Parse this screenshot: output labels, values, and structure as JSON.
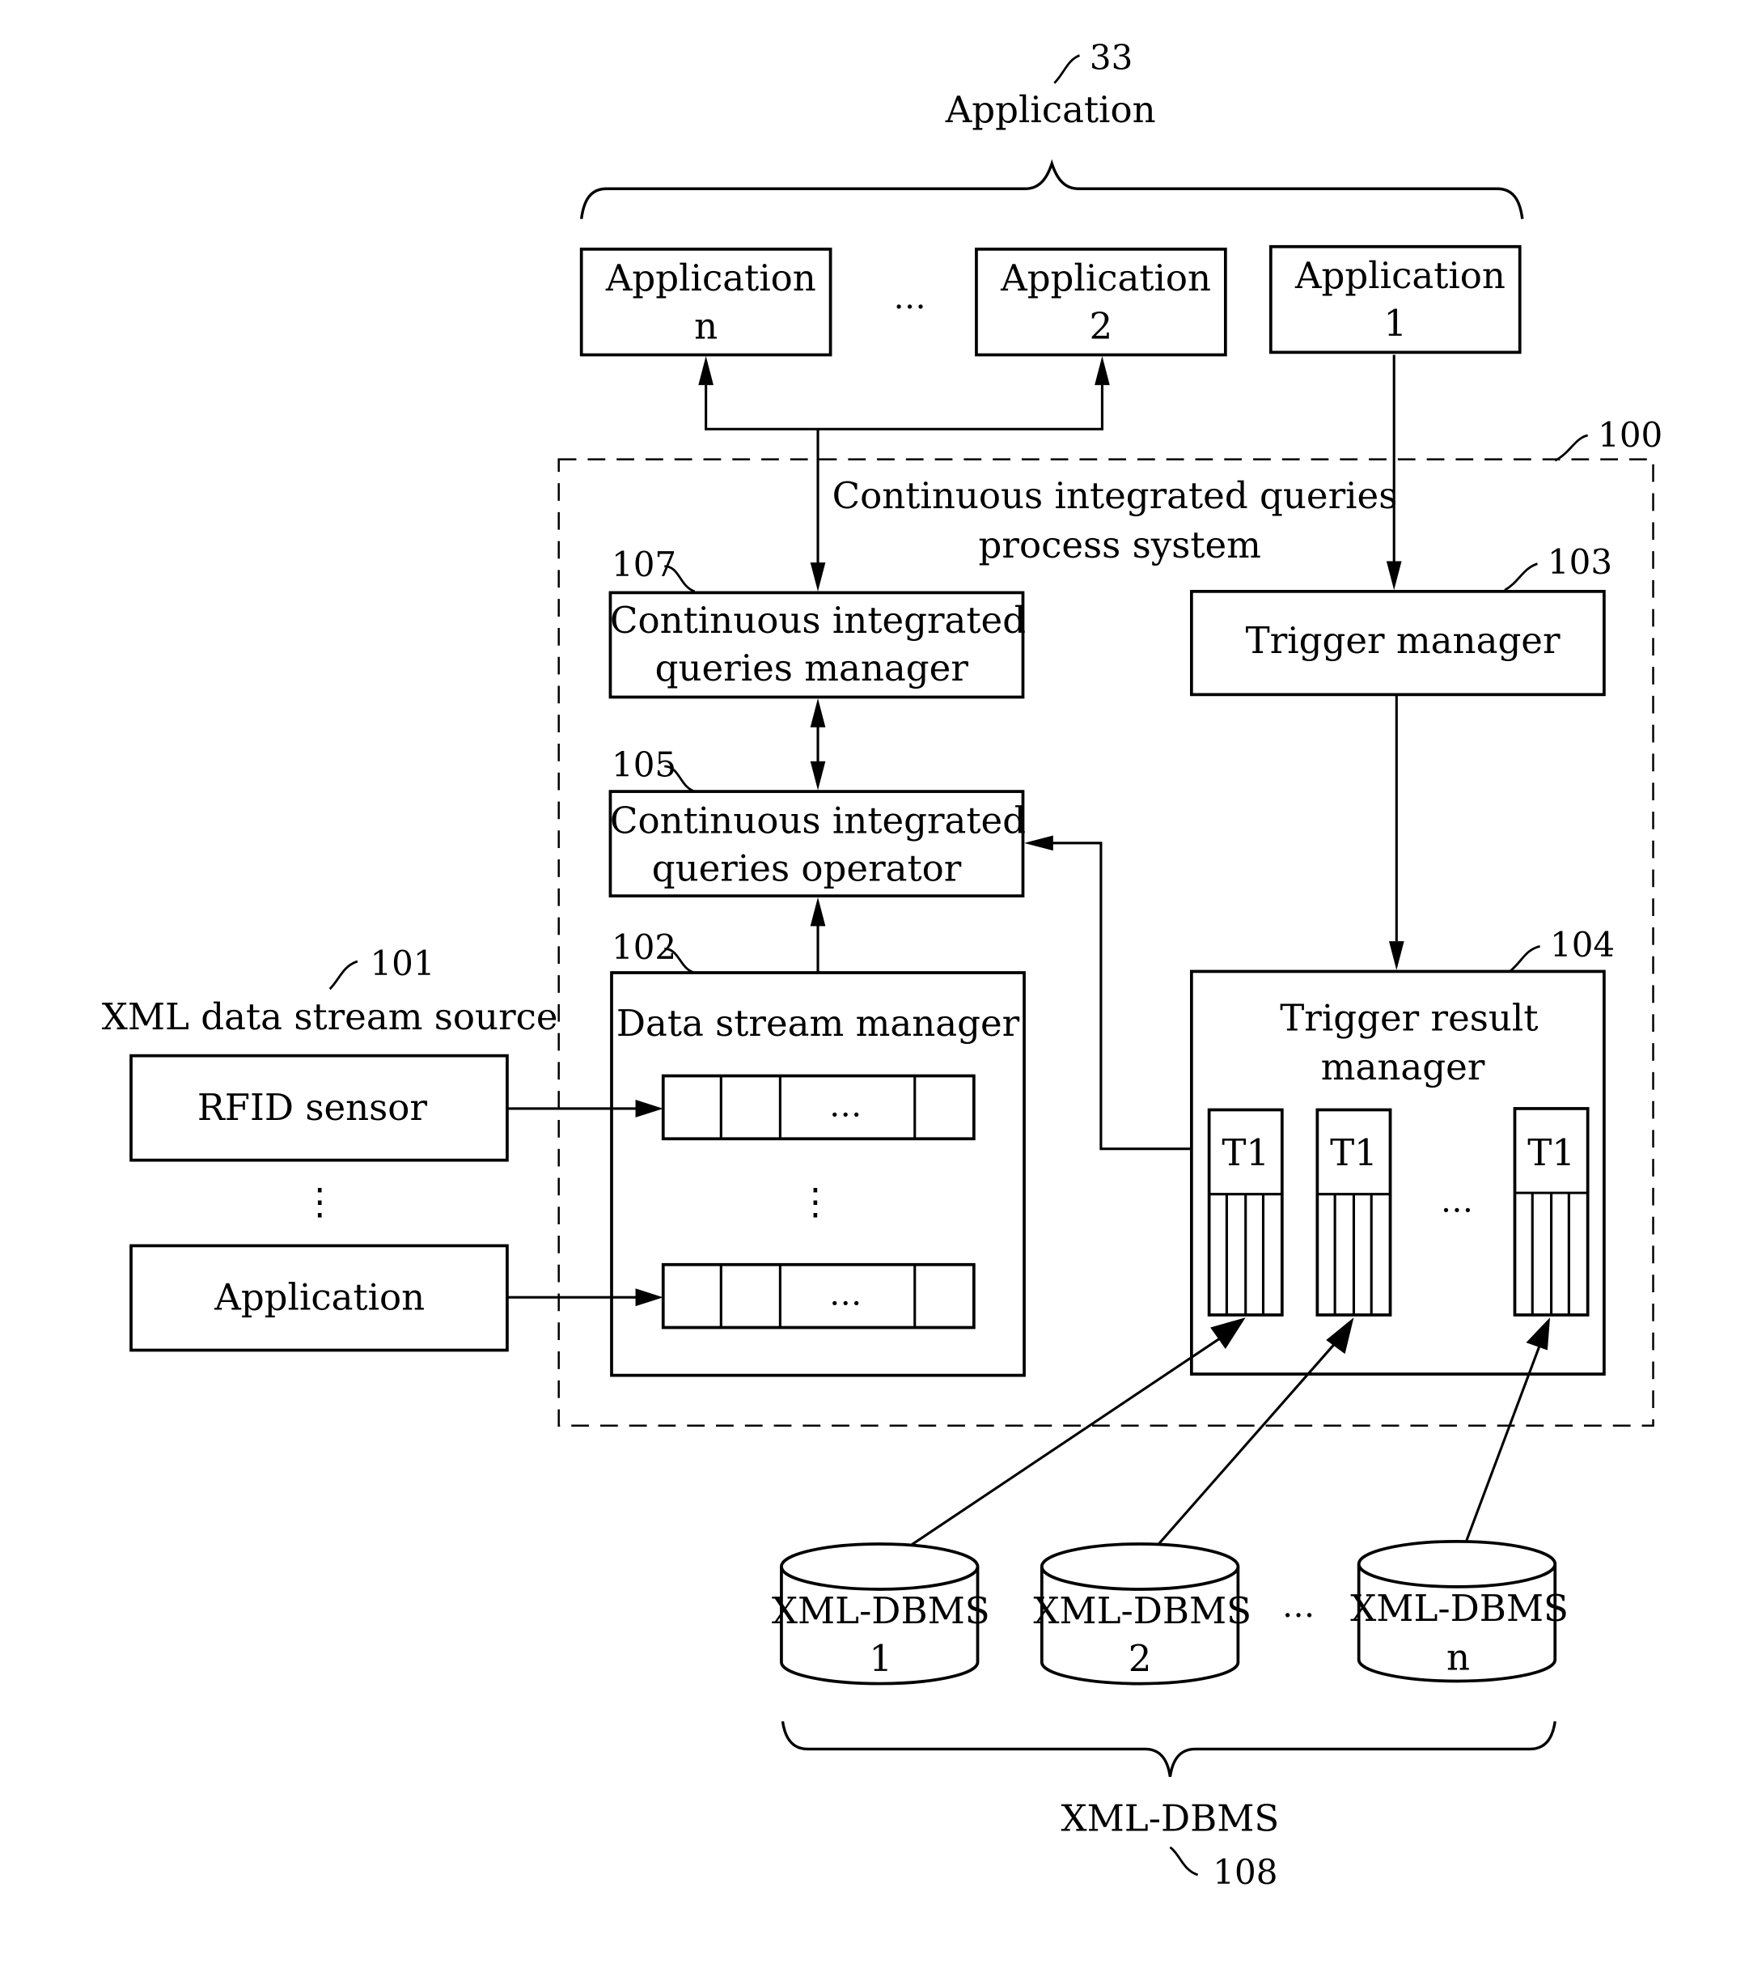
{
  "figure": {
    "application_group": {
      "label": "Application",
      "ref": "33"
    },
    "applications": [
      {
        "line1": "Application",
        "line2": "n"
      },
      {
        "line1": "Application",
        "line2": "2"
      },
      {
        "line1": "Application",
        "line2": "1"
      }
    ],
    "ellipsis": "…",
    "vdots": "⋮",
    "system": {
      "line1": "Continuous integrated queries",
      "line2": "process system",
      "ref": "100"
    },
    "cq_manager": {
      "line1": "Continuous integrated",
      "line2": "queries manager",
      "ref": "107"
    },
    "cq_operator": {
      "line1": "Continuous integrated",
      "line2": "queries operator",
      "ref": "105"
    },
    "trigger_manager": {
      "label": "Trigger manager",
      "ref": "103"
    },
    "data_stream_manager": {
      "label": "Data stream manager",
      "ref": "102"
    },
    "trigger_result_manager": {
      "line1": "Trigger result",
      "line2": "manager",
      "ref": "104",
      "tables": [
        "T1",
        "T1",
        "T1"
      ]
    },
    "stream_source": {
      "label": "XML data stream source",
      "ref": "101",
      "items": [
        "RFID sensor",
        "Application"
      ]
    },
    "databases": [
      {
        "line1": "XML-DBMS",
        "line2": "1"
      },
      {
        "line1": "XML-DBMS",
        "line2": "2"
      },
      {
        "line1": "XML-DBMS",
        "line2": "n"
      }
    ],
    "database_group": {
      "label": "XML-DBMS",
      "ref": "108"
    }
  }
}
